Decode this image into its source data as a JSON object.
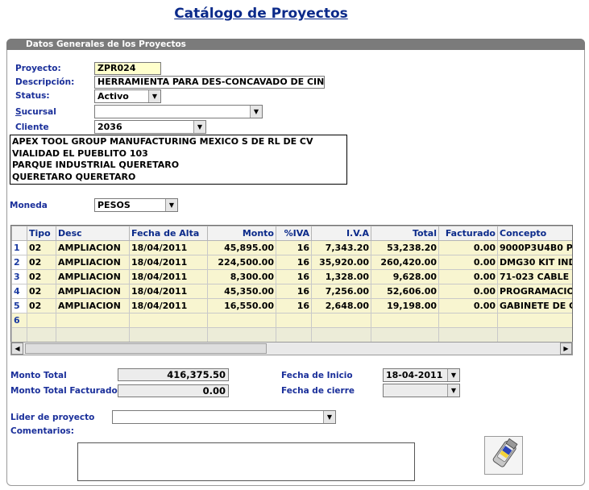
{
  "page_title": "Catálogo de Proyectos",
  "panel_title": "Datos Generales de los Proyectos",
  "fields": {
    "proyecto": {
      "label": "Proyecto:",
      "value": "ZPR024"
    },
    "descripcion": {
      "label": "Descripción:",
      "value": "HERRAMIENTA PARA DES-CONCAVADO DE CINTA"
    },
    "status": {
      "label": "Status:",
      "value": "Activo"
    },
    "sucursal": {
      "label": "Sucursal",
      "value": ""
    },
    "cliente": {
      "label": "Cliente",
      "value": "2036"
    },
    "address_lines": [
      "APEX TOOL GROUP MANUFACTURING MEXICO S DE RL DE CV",
      "VIALIDAD EL PUEBLITO 103",
      "PARQUE INDUSTRIAL QUERETARO",
      "QUERETARO QUERETARO"
    ],
    "moneda": {
      "label": "Moneda",
      "value": "PESOS"
    }
  },
  "grid": {
    "columns": [
      "Tipo",
      "Desc",
      "Fecha de Alta",
      "Monto",
      "%IVA",
      "I.V.A",
      "Total",
      "Facturado",
      "Concepto"
    ],
    "rows": [
      {
        "n": "1",
        "tipo": "02",
        "desc": "AMPLIACION",
        "fecha": "18/04/2011",
        "monto": "45,895.00",
        "piva": "16",
        "iva": "7,343.20",
        "total": "53,238.20",
        "facturado": "0.00",
        "concepto": "9000P3U4B0 P"
      },
      {
        "n": "2",
        "tipo": "02",
        "desc": "AMPLIACION",
        "fecha": "18/04/2011",
        "monto": "224,500.00",
        "piva": "16",
        "iva": "35,920.00",
        "total": "260,420.00",
        "facturado": "0.00",
        "concepto": "DMG30 KIT IND"
      },
      {
        "n": "3",
        "tipo": "02",
        "desc": "AMPLIACION",
        "fecha": "18/04/2011",
        "monto": "8,300.00",
        "piva": "16",
        "iva": "1,328.00",
        "total": "9,628.00",
        "facturado": "0.00",
        "concepto": "71-023 CABLE"
      },
      {
        "n": "4",
        "tipo": "02",
        "desc": "AMPLIACION",
        "fecha": "18/04/2011",
        "monto": "45,350.00",
        "piva": "16",
        "iva": "7,256.00",
        "total": "52,606.00",
        "facturado": "0.00",
        "concepto": "PROGRAMACIO"
      },
      {
        "n": "5",
        "tipo": "02",
        "desc": "AMPLIACION",
        "fecha": "18/04/2011",
        "monto": "16,550.00",
        "piva": "16",
        "iva": "2,648.00",
        "total": "19,198.00",
        "facturado": "0.00",
        "concepto": "GABINETE DE C"
      },
      {
        "n": "6",
        "tipo": "",
        "desc": "",
        "fecha": "",
        "monto": "",
        "piva": "",
        "iva": "",
        "total": "",
        "facturado": "",
        "concepto": ""
      }
    ]
  },
  "totals": {
    "monto_total": {
      "label": "Monto Total",
      "value": "416,375.50"
    },
    "monto_total_facturado": {
      "label": "Monto Total Facturado",
      "value": "0.00"
    },
    "fecha_inicio": {
      "label": "Fecha de Inicio",
      "value": "18-04-2011"
    },
    "fecha_cierre": {
      "label": "Fecha de cierre",
      "value": ""
    }
  },
  "lider": {
    "label": "Lider de proyecto",
    "value": ""
  },
  "comentarios": {
    "label": "Comentarios:",
    "value": ""
  },
  "icons": {
    "save": "usb-drive-icon",
    "dropdown": "chevron-down-icon"
  },
  "colors": {
    "label_blue": "#1a2f9a",
    "title_blue": "#0b2a8a",
    "row_yellow": "#f8f5d0",
    "header_gray": "#7b7b7b"
  }
}
